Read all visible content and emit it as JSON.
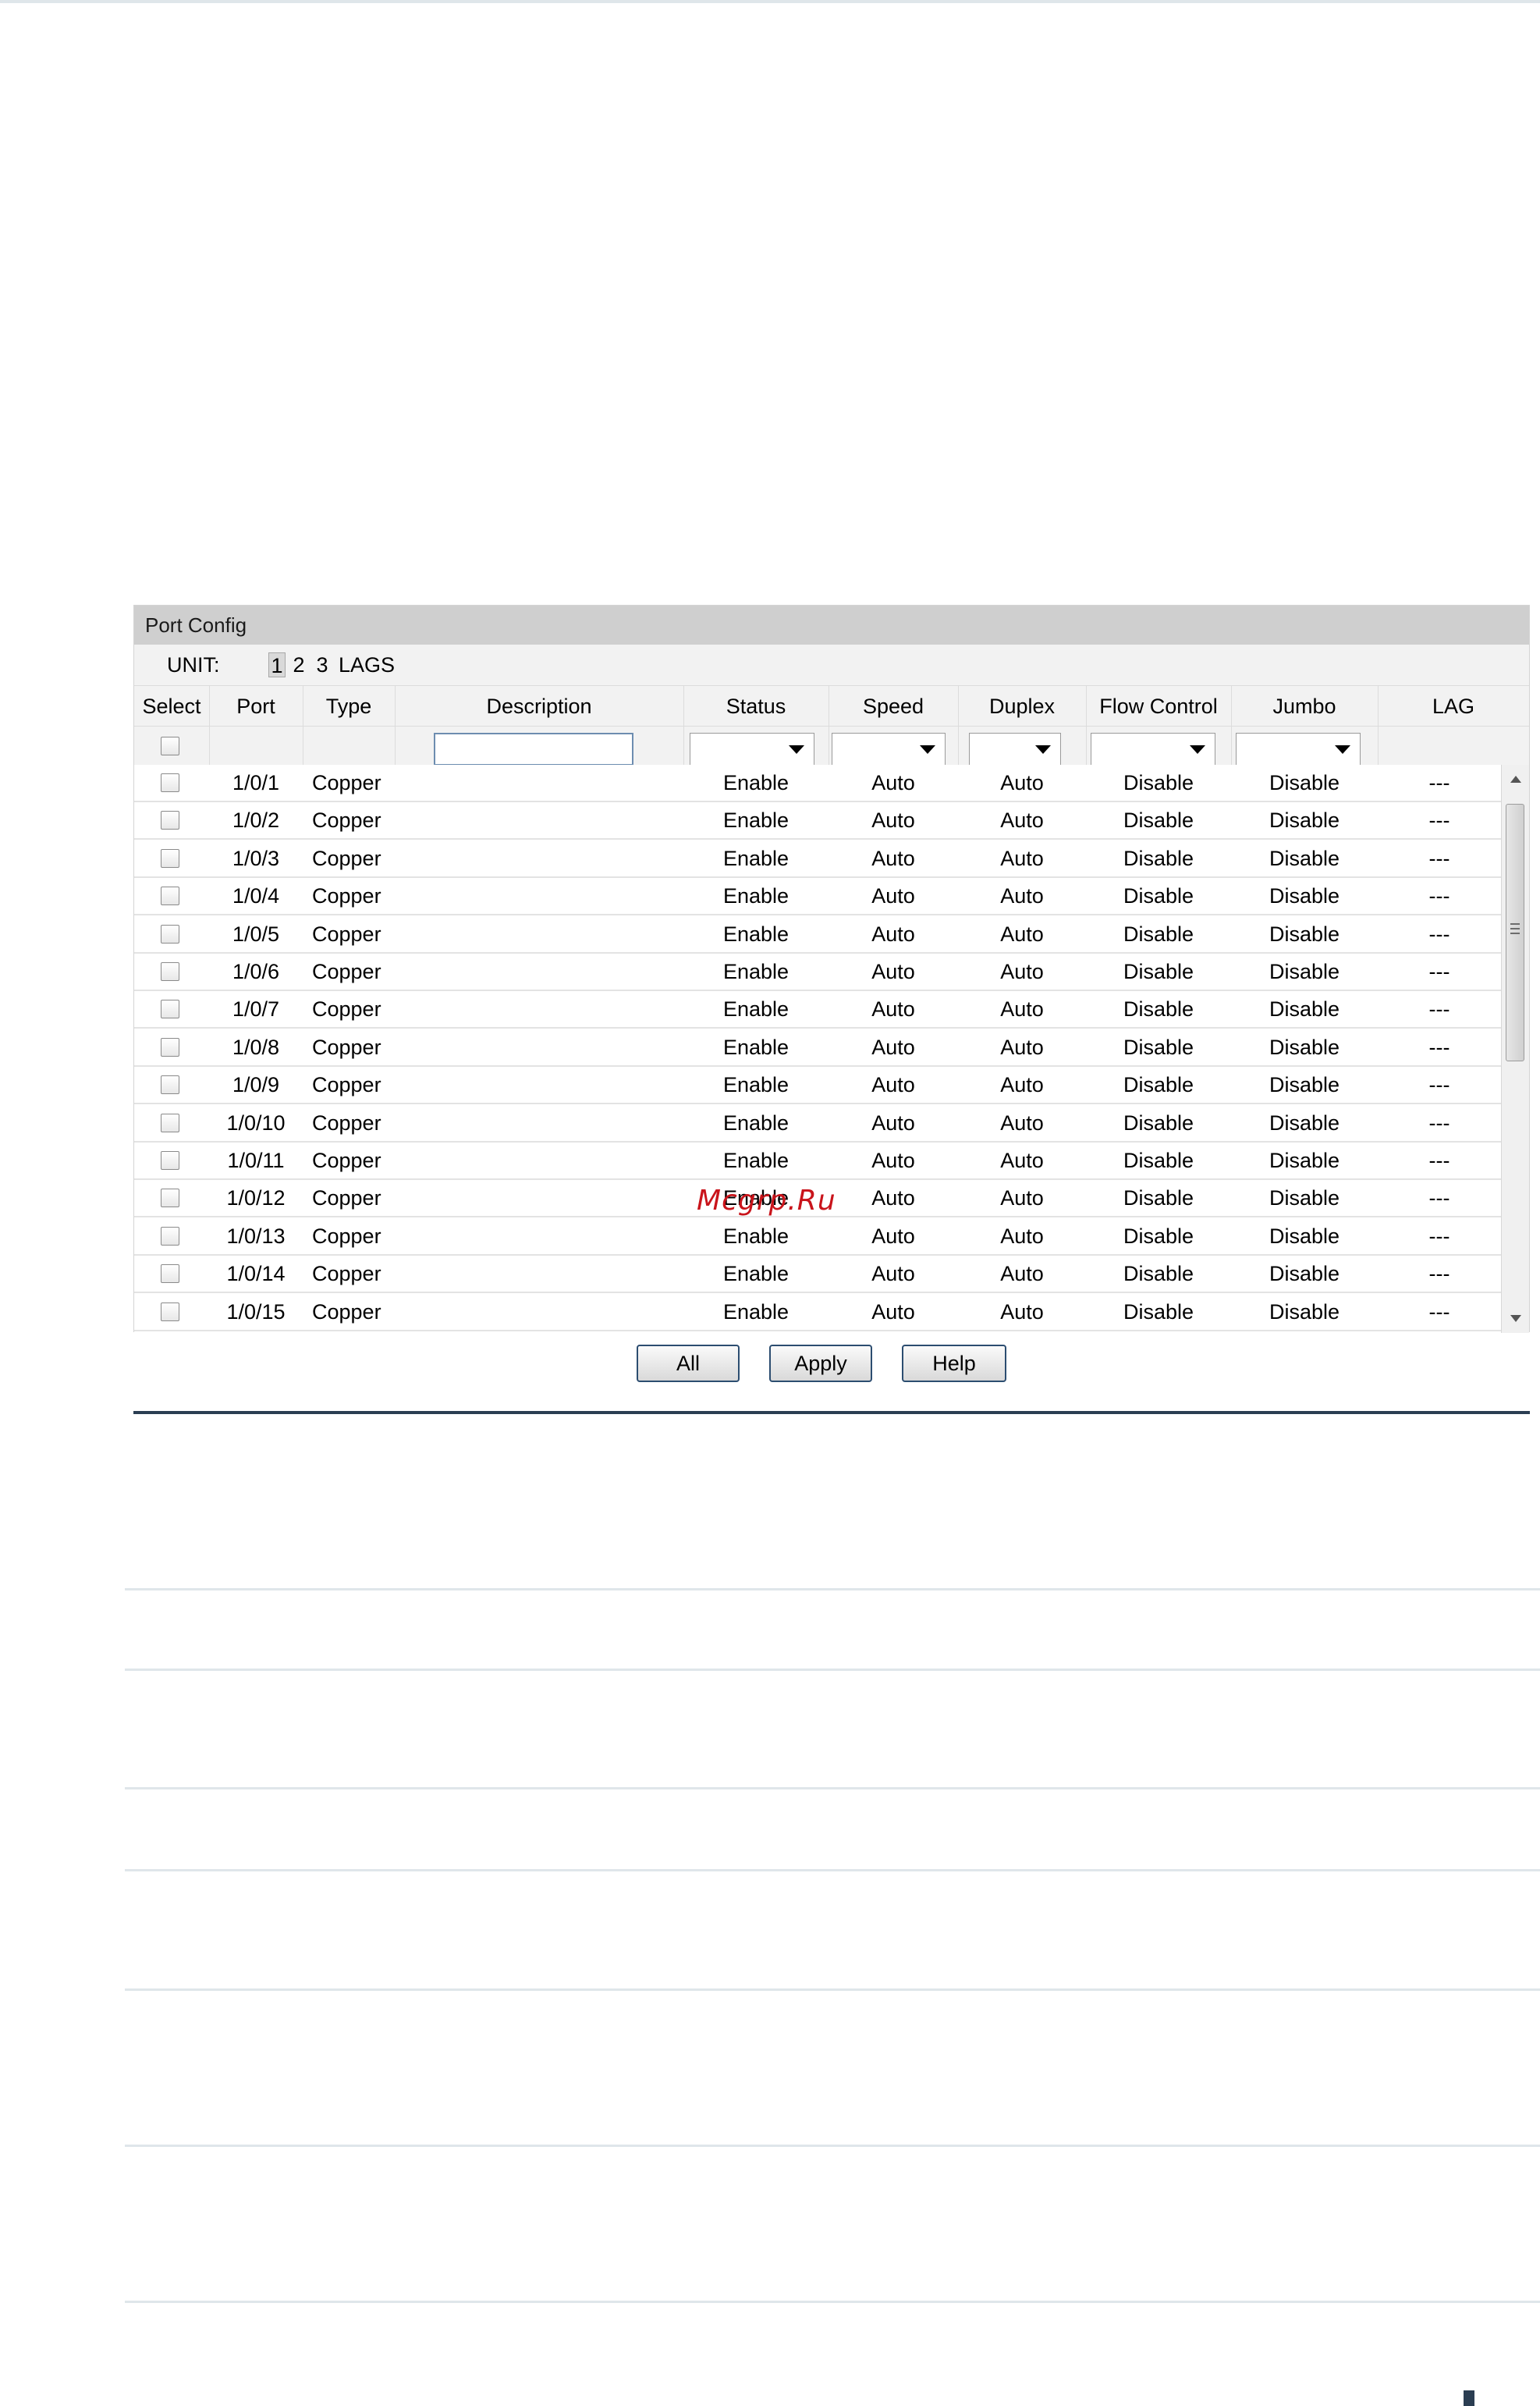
{
  "panel": {
    "title": "Port Config",
    "unit_label": "UNIT:",
    "unit_links": [
      "1",
      "2",
      "3",
      "LAGS"
    ],
    "active_unit": "1"
  },
  "table": {
    "headers": [
      "Select",
      "Port",
      "Type",
      "Description",
      "Status",
      "Speed",
      "Duplex",
      "Flow Control",
      "Jumbo",
      "LAG"
    ],
    "filter": {
      "description_value": "",
      "status_selected": "",
      "speed_selected": "",
      "duplex_selected": "",
      "flow_control_selected": "",
      "jumbo_selected": ""
    },
    "rows": [
      {
        "port": "1/0/1",
        "type": "Copper",
        "description": "",
        "status": "Enable",
        "speed": "Auto",
        "duplex": "Auto",
        "flow_control": "Disable",
        "jumbo": "Disable",
        "lag": "---"
      },
      {
        "port": "1/0/2",
        "type": "Copper",
        "description": "",
        "status": "Enable",
        "speed": "Auto",
        "duplex": "Auto",
        "flow_control": "Disable",
        "jumbo": "Disable",
        "lag": "---"
      },
      {
        "port": "1/0/3",
        "type": "Copper",
        "description": "",
        "status": "Enable",
        "speed": "Auto",
        "duplex": "Auto",
        "flow_control": "Disable",
        "jumbo": "Disable",
        "lag": "---"
      },
      {
        "port": "1/0/4",
        "type": "Copper",
        "description": "",
        "status": "Enable",
        "speed": "Auto",
        "duplex": "Auto",
        "flow_control": "Disable",
        "jumbo": "Disable",
        "lag": "---"
      },
      {
        "port": "1/0/5",
        "type": "Copper",
        "description": "",
        "status": "Enable",
        "speed": "Auto",
        "duplex": "Auto",
        "flow_control": "Disable",
        "jumbo": "Disable",
        "lag": "---"
      },
      {
        "port": "1/0/6",
        "type": "Copper",
        "description": "",
        "status": "Enable",
        "speed": "Auto",
        "duplex": "Auto",
        "flow_control": "Disable",
        "jumbo": "Disable",
        "lag": "---"
      },
      {
        "port": "1/0/7",
        "type": "Copper",
        "description": "",
        "status": "Enable",
        "speed": "Auto",
        "duplex": "Auto",
        "flow_control": "Disable",
        "jumbo": "Disable",
        "lag": "---"
      },
      {
        "port": "1/0/8",
        "type": "Copper",
        "description": "",
        "status": "Enable",
        "speed": "Auto",
        "duplex": "Auto",
        "flow_control": "Disable",
        "jumbo": "Disable",
        "lag": "---"
      },
      {
        "port": "1/0/9",
        "type": "Copper",
        "description": "",
        "status": "Enable",
        "speed": "Auto",
        "duplex": "Auto",
        "flow_control": "Disable",
        "jumbo": "Disable",
        "lag": "---"
      },
      {
        "port": "1/0/10",
        "type": "Copper",
        "description": "",
        "status": "Enable",
        "speed": "Auto",
        "duplex": "Auto",
        "flow_control": "Disable",
        "jumbo": "Disable",
        "lag": "---"
      },
      {
        "port": "1/0/11",
        "type": "Copper",
        "description": "",
        "status": "Enable",
        "speed": "Auto",
        "duplex": "Auto",
        "flow_control": "Disable",
        "jumbo": "Disable",
        "lag": "---"
      },
      {
        "port": "1/0/12",
        "type": "Copper",
        "description": "",
        "status": "Enable",
        "speed": "Auto",
        "duplex": "Auto",
        "flow_control": "Disable",
        "jumbo": "Disable",
        "lag": "---"
      },
      {
        "port": "1/0/13",
        "type": "Copper",
        "description": "",
        "status": "Enable",
        "speed": "Auto",
        "duplex": "Auto",
        "flow_control": "Disable",
        "jumbo": "Disable",
        "lag": "---"
      },
      {
        "port": "1/0/14",
        "type": "Copper",
        "description": "",
        "status": "Enable",
        "speed": "Auto",
        "duplex": "Auto",
        "flow_control": "Disable",
        "jumbo": "Disable",
        "lag": "---"
      },
      {
        "port": "1/0/15",
        "type": "Copper",
        "description": "",
        "status": "Enable",
        "speed": "Auto",
        "duplex": "Auto",
        "flow_control": "Disable",
        "jumbo": "Disable",
        "lag": "---"
      }
    ]
  },
  "buttons": {
    "all": "All",
    "apply": "Apply",
    "help": "Help"
  },
  "watermark": "Mcgrp.Ru",
  "icons": {
    "dropdown_arrow": "dropdown-arrow-icon",
    "scroll_up": "scroll-up-arrow-icon",
    "scroll_down": "scroll-down-arrow-icon",
    "scroll_grip": "scroll-grip-icon"
  }
}
